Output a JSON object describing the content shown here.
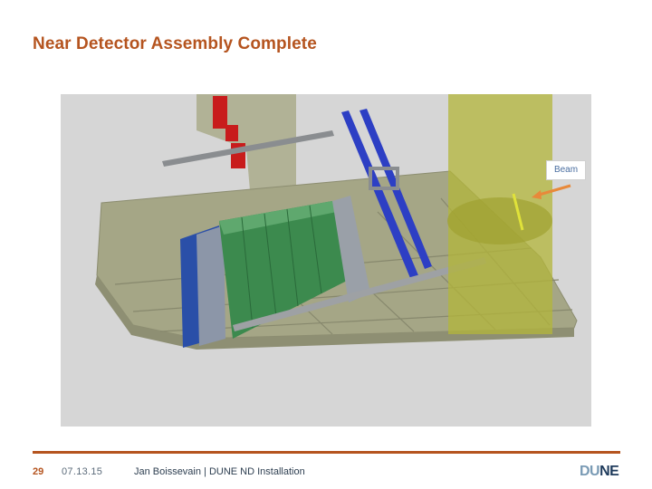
{
  "slide": {
    "title": "Near Detector Assembly  Complete"
  },
  "figure": {
    "callout_label": "Beam",
    "colors": {
      "floor": "#a5a686",
      "floor_edge": "#8c8d70",
      "detector_green": "#3c8a4e",
      "detector_blue": "#2a4fa8",
      "rail_blue": "#2d3fc4",
      "red_blocks": "#c81c1c",
      "beam_pipe": "#b3b53a",
      "beam_arrow": "#e8893a"
    }
  },
  "footer": {
    "page_number": "29",
    "date": "07.13.15",
    "author_line": "Jan Boissevain | DUNE ND Installation",
    "logo_left": "DU",
    "logo_right": "NE"
  }
}
